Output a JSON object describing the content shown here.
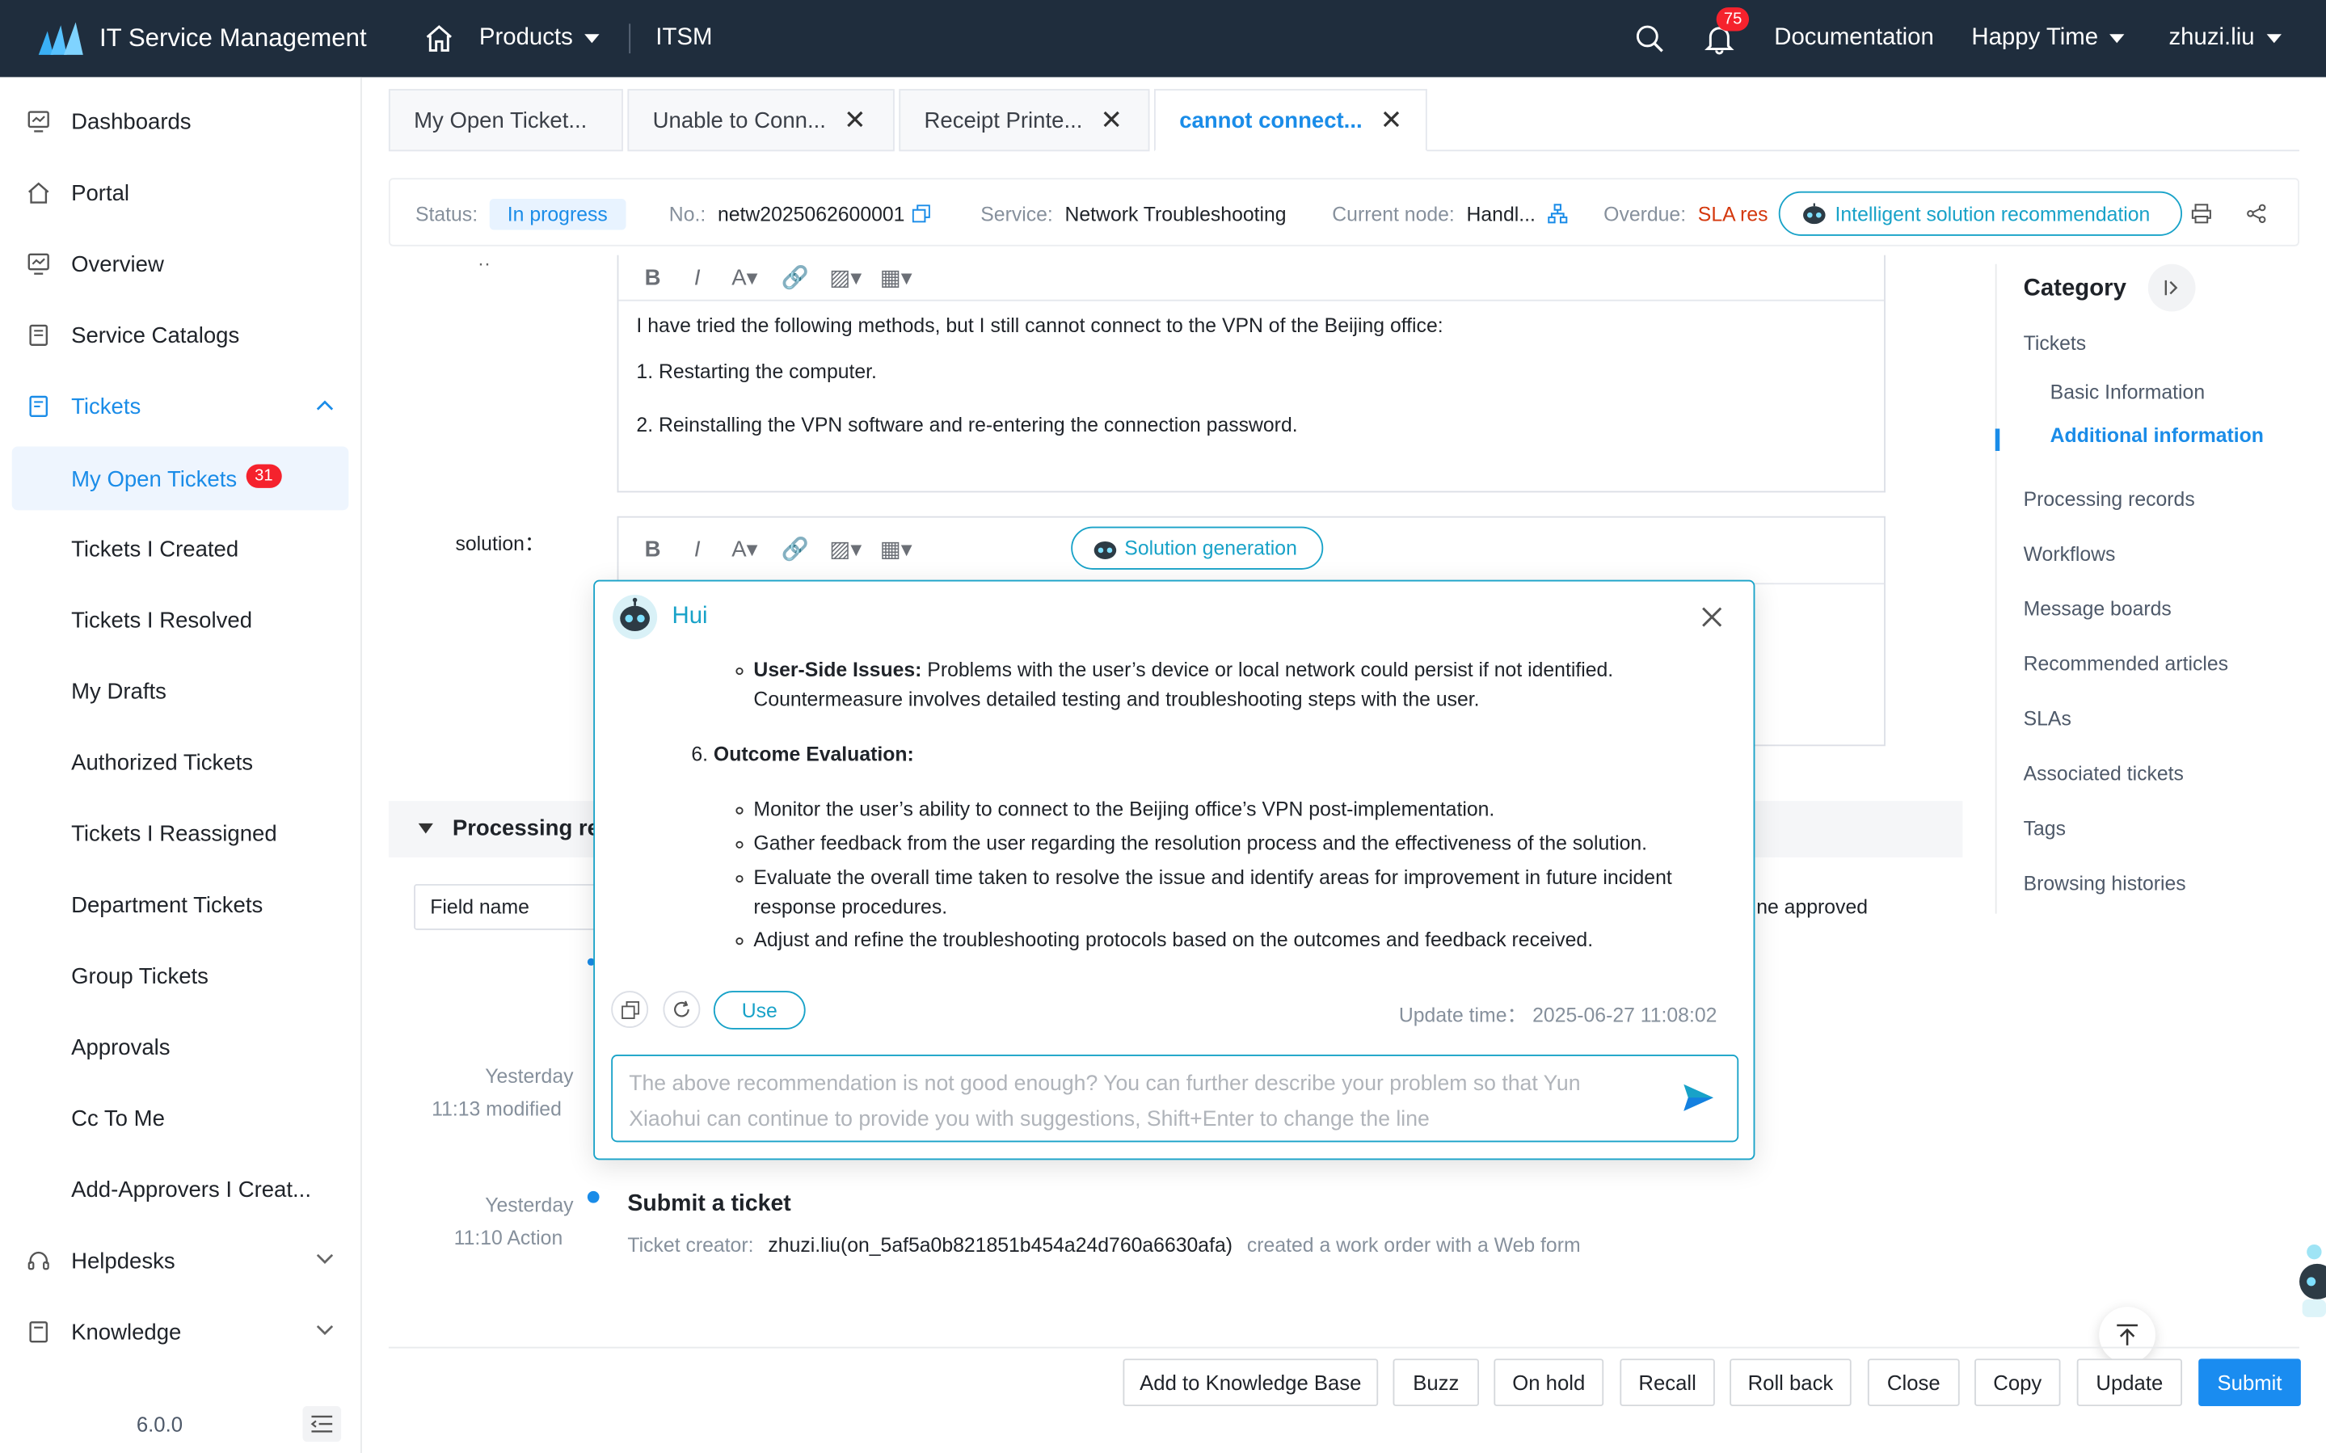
{
  "topbar": {
    "app_title": "IT Service Management",
    "products_label": "Products",
    "module_label": "ITSM",
    "notification_count": "75",
    "documentation_label": "Documentation",
    "workspace_label": "Happy Time",
    "user_label": "zhuzi.liu"
  },
  "sidebar": {
    "items": [
      {
        "label": "Dashboards",
        "icon": "dashboard-icon"
      },
      {
        "label": "Portal",
        "icon": "home-icon"
      },
      {
        "label": "Overview",
        "icon": "monitor-icon"
      },
      {
        "label": "Service Catalogs",
        "icon": "book-icon"
      },
      {
        "label": "Tickets",
        "icon": "ticket-icon"
      }
    ],
    "ticket_subitems": [
      {
        "label": "My Open Tickets",
        "badge": "31"
      },
      {
        "label": "Tickets I Created"
      },
      {
        "label": "Tickets I Resolved"
      },
      {
        "label": "My Drafts"
      },
      {
        "label": "Authorized Tickets"
      },
      {
        "label": "Tickets I Reassigned"
      },
      {
        "label": "Department Tickets"
      },
      {
        "label": "Group Tickets"
      },
      {
        "label": "Approvals"
      },
      {
        "label": "Cc To Me"
      },
      {
        "label": "Add-Approvers I Creat..."
      }
    ],
    "helpdesks_label": "Helpdesks",
    "knowledge_label": "Knowledge",
    "version": "6.0.0"
  },
  "tabs": [
    {
      "label": "My Open Ticket..."
    },
    {
      "label": "Unable to Conn..."
    },
    {
      "label": "Receipt Printe..."
    },
    {
      "label": "cannot connect..."
    }
  ],
  "status_bar": {
    "status_label": "Status:",
    "status_value": "In progress",
    "no_label": "No.:",
    "no_value": "netw2025062600001",
    "service_label": "Service:",
    "service_value": "Network Troubleshooting",
    "node_label": "Current node:",
    "node_value": "Handl...",
    "overdue_label": "Overdue:",
    "overdue_value": "SLA res",
    "recommend_label": "Intelligent solution recommendation"
  },
  "description": {
    "intro": "I have tried the following methods, but I still cannot connect to the VPN of the Beijing office:",
    "steps": [
      "1.  Restarting the computer.",
      "2.  Reinstalling the VPN software and re-entering the connection password."
    ]
  },
  "solution": {
    "label": "solution：",
    "generate_label": "Solution generation"
  },
  "assistant": {
    "name": "Hui",
    "user_side_title": "User-Side Issues:",
    "user_side_text_1": " Problems with the user’s device or local network could persist if not identified.",
    "user_side_text_2": "Countermeasure involves detailed testing and troubleshooting steps with the user.",
    "outcome_number": "6.",
    "outcome_title": "Outcome Evaluation:",
    "outcome_bullets": [
      "Monitor the user’s ability to connect to the Beijing office’s VPN post-implementation.",
      "Gather feedback from the user regarding the resolution process and the effectiveness of the solution.",
      "Evaluate the overall time taken to resolve the issue and identify areas for improvement in future incident",
      "Adjust and refine the troubleshooting protocols based on the outcomes and feedback received."
    ],
    "outcome_bullet_3_cont": "response procedures.",
    "use_label": "Use",
    "update_time": "Update time： 2025-06-27 11:08:02",
    "input_placeholder_1": "The above recommendation is not good enough? You can further describe your problem so that Yun",
    "input_placeholder_2": "Xiaohui can continue to provide you with suggestions, Shift+Enter to change the line"
  },
  "processing": {
    "title": "Processing re",
    "field_name_label": "Field name",
    "approved_text": "ne approved",
    "entries": [
      {
        "date": "Yesterday",
        "time": "11:13 modified"
      },
      {
        "date": "Yesterday",
        "time": "11:10 Action",
        "title": "Submit a ticket",
        "creator_label": "Ticket creator:",
        "creator": "zhuzi.liu(on_5af5a0b821851b454a24d760a6630afa)",
        "action": "created a work order with a Web form"
      }
    ]
  },
  "category": {
    "title": "Category",
    "items": [
      {
        "label": "Tickets"
      },
      {
        "label": "Basic Information"
      },
      {
        "label": "Additional information"
      },
      {
        "label": "Processing records"
      },
      {
        "label": "Workflows"
      },
      {
        "label": "Message boards"
      },
      {
        "label": "Recommended articles"
      },
      {
        "label": "SLAs"
      },
      {
        "label": "Associated tickets"
      },
      {
        "label": "Tags"
      },
      {
        "label": "Browsing histories"
      }
    ]
  },
  "actions": [
    {
      "label": "Add to Knowledge Base"
    },
    {
      "label": "Buzz"
    },
    {
      "label": "On hold"
    },
    {
      "label": "Recall"
    },
    {
      "label": "Roll back"
    },
    {
      "label": "Close"
    },
    {
      "label": "Copy"
    },
    {
      "label": "Update"
    },
    {
      "label": "Submit"
    }
  ],
  "colors": {
    "topbar": "#1f2d3d",
    "accent": "#1a8ce8",
    "teal": "#18a2c8",
    "danger": "#f5222d"
  }
}
